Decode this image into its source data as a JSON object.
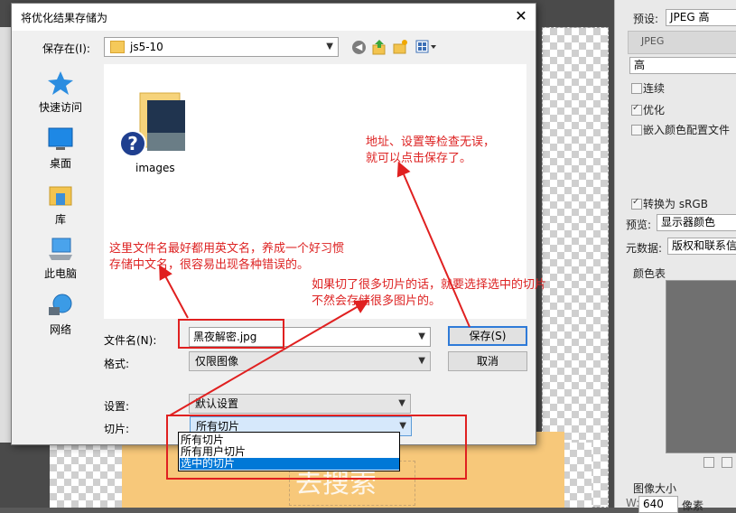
{
  "dialog": {
    "title": "将优化结果存储为",
    "save_in_label": "保存在(I):",
    "save_in_value": "js5-10",
    "places": [
      {
        "label": "快速访问"
      },
      {
        "label": "桌面"
      },
      {
        "label": "库"
      },
      {
        "label": "此电脑"
      },
      {
        "label": "网络"
      }
    ],
    "files": [
      {
        "name": "images"
      }
    ],
    "filename_label": "文件名(N):",
    "filename_value": "黑夜解密.jpg",
    "format_label": "格式:",
    "format_value": "仅限图像",
    "settings_label": "设置:",
    "settings_value": "默认设置",
    "slices_label": "切片:",
    "slices_value": "所有切片",
    "slices_options": [
      "所有切片",
      "所有用户切片",
      "选中的切片"
    ],
    "save_button": "保存(S)",
    "cancel_button": "取消"
  },
  "annotations": {
    "address_note": [
      "地址、设置等检查无误，",
      "就可以点击保存了。"
    ],
    "filename_note": [
      "这里文件名最好都用英文名，养成一个好习惯",
      "存储中文名，很容易出现各种错误的。"
    ],
    "slices_note": [
      "如果切了很多切片的话，就要选择选中的切片",
      "不然会存储很多图片的。"
    ]
  },
  "right_panel": {
    "preset_label": "预设:",
    "preset_value": "JPEG 高",
    "format_value": "JPEG",
    "quality_value": "高",
    "progressive_label": "连续",
    "optimized_label": "优化",
    "embed_profile_label": "嵌入颜色配置文件",
    "convert_srgb_label": "转换为 sRGB",
    "preview_label": "预览:",
    "preview_value": "显示器颜色",
    "metadata_label": "元数据:",
    "metadata_value": "版权和联系信",
    "color_table_label": "颜色表",
    "image_size_label": "图像大小",
    "width_label": "W:",
    "width_value": "640",
    "unit_label": "像素"
  },
  "artwork_text": "去搜索",
  "colors": {
    "annotation_red": "#dd2222",
    "selection_blue": "#0078d7",
    "default_button_border": "#2f7bd8"
  }
}
